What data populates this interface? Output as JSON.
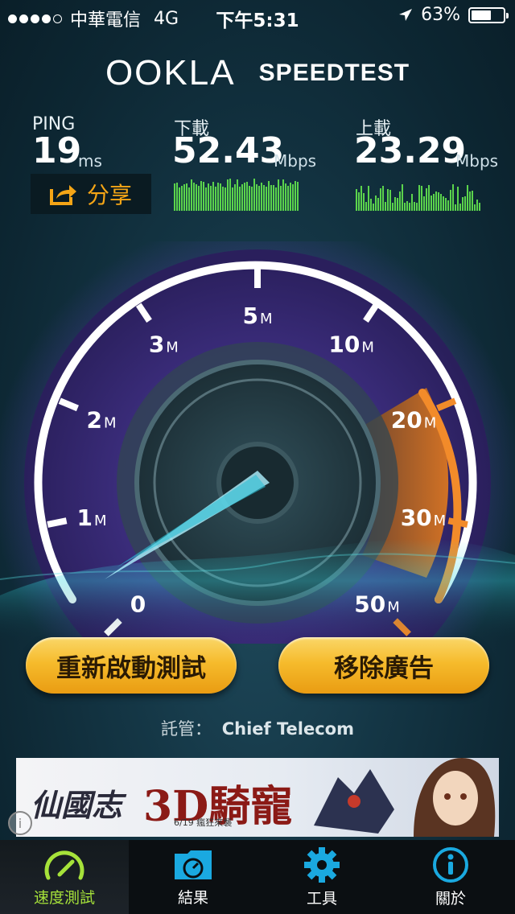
{
  "status": {
    "carrier": "中華電信",
    "network": "4G",
    "time": "下午5:31",
    "battery_pct": "63%",
    "battery_level": 0.63
  },
  "brand": {
    "logo": "OOKLA",
    "product": "SPEEDTEST"
  },
  "stats": {
    "ping": {
      "label": "PING",
      "value": "19",
      "unit": "ms"
    },
    "download": {
      "label": "下載",
      "value": "52.43",
      "unit": "Mbps"
    },
    "upload": {
      "label": "上載",
      "value": "23.29",
      "unit": "Mbps"
    }
  },
  "share": {
    "label": "分享",
    "icon": "share-arrow-icon"
  },
  "gauge": {
    "ticks": [
      {
        "num": "0",
        "unit": ""
      },
      {
        "num": "1",
        "unit": "M"
      },
      {
        "num": "2",
        "unit": "M"
      },
      {
        "num": "3",
        "unit": "M"
      },
      {
        "num": "5",
        "unit": "M"
      },
      {
        "num": "10",
        "unit": "M"
      },
      {
        "num": "20",
        "unit": "M"
      },
      {
        "num": "30",
        "unit": "M"
      },
      {
        "num": "50",
        "unit": "M"
      }
    ],
    "needle_value": 0
  },
  "buttons": {
    "restart": "重新啟動測試",
    "remove_ads": "移除廣告"
  },
  "host": {
    "label": "託管：",
    "name": "Chief Telecom"
  },
  "ad": {
    "text_1": "仙國志",
    "text_2": "3D騎寵",
    "date": "6/19 瘋狂來襲"
  },
  "tabs": [
    {
      "label": "速度測試",
      "icon": "speedometer-icon"
    },
    {
      "label": "結果",
      "icon": "results-folder-icon"
    },
    {
      "label": "工具",
      "icon": "gear-icon"
    },
    {
      "label": "關於",
      "icon": "info-icon"
    }
  ],
  "colors": {
    "accent": "#f6bb2c",
    "active_tab": "#a6e23a",
    "tab_icon": "#1aa9e0",
    "bars": "#5bd44c"
  }
}
